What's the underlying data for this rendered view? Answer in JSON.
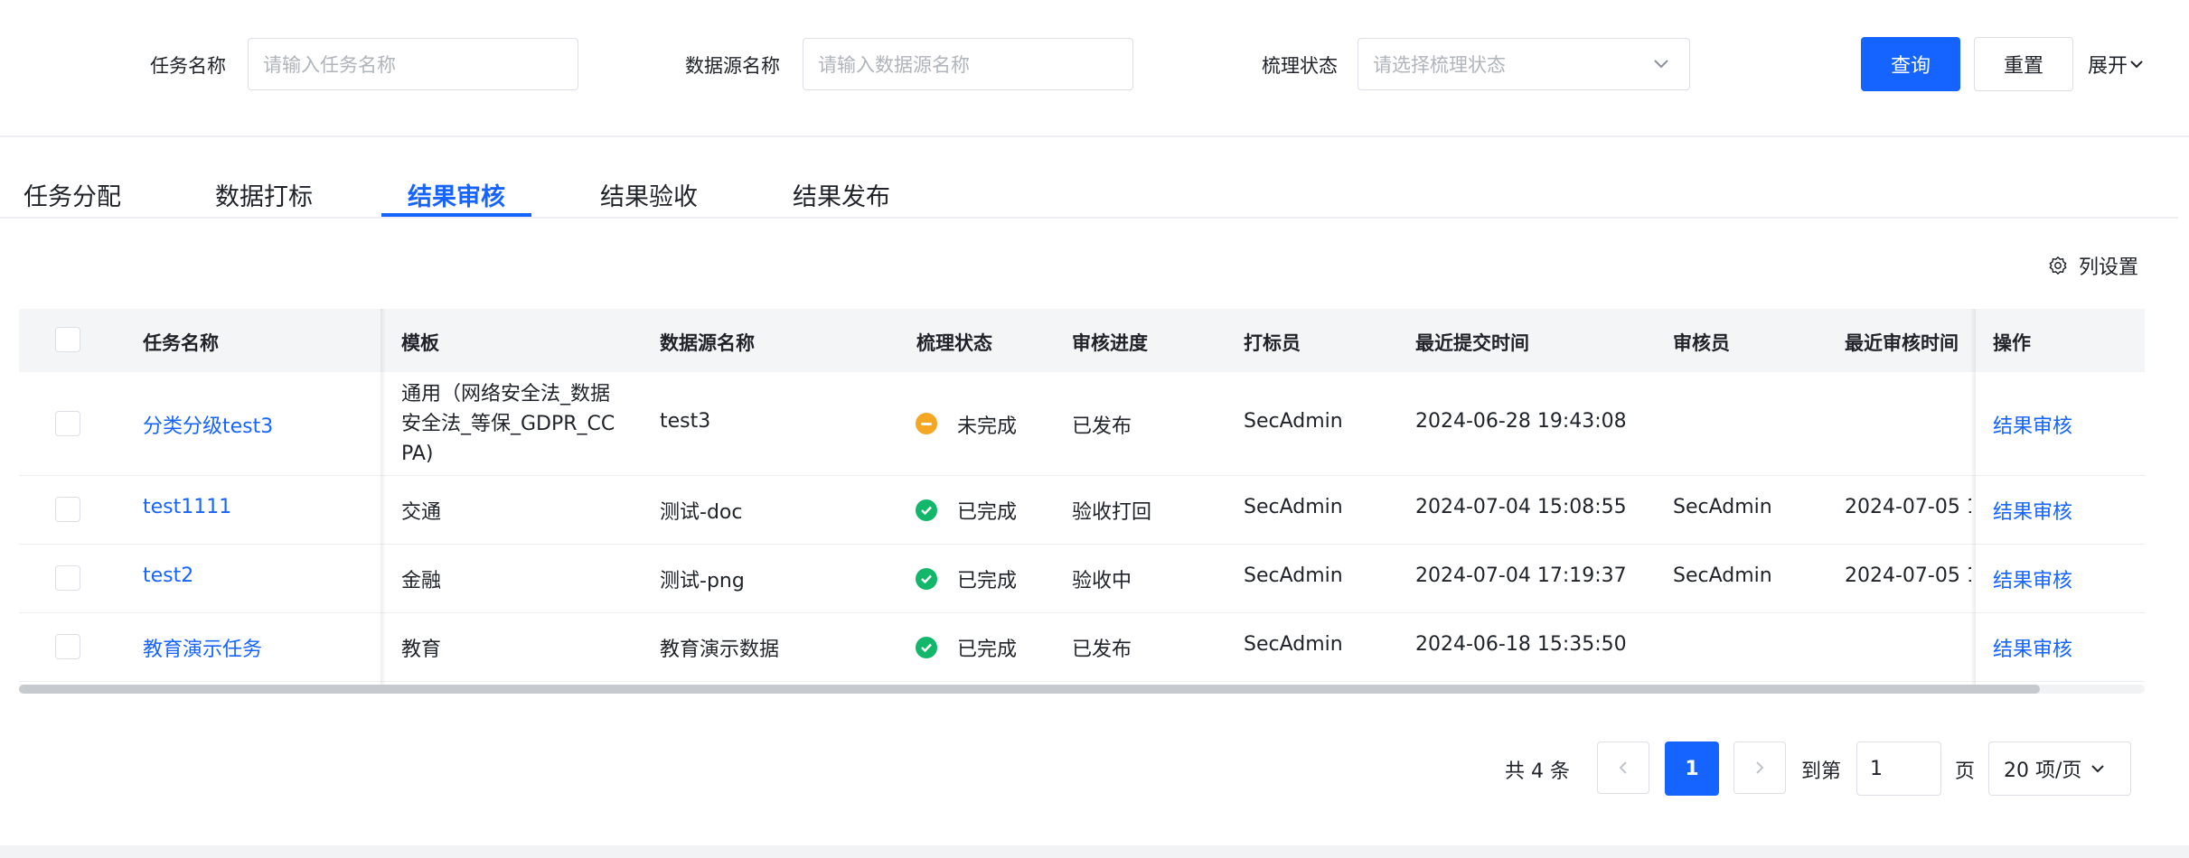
{
  "filters": {
    "task_name_label": "任务名称",
    "task_name_placeholder": "请输入任务名称",
    "datasource_label": "数据源名称",
    "datasource_placeholder": "请输入数据源名称",
    "status_label": "梳理状态",
    "status_placeholder": "请选择梳理状态",
    "query_button": "查询",
    "reset_button": "重置",
    "expand_button": "展开"
  },
  "tabs": [
    "任务分配",
    "数据打标",
    "结果审核",
    "结果验收",
    "结果发布"
  ],
  "active_tab": "结果审核",
  "column_settings": "列设置",
  "table": {
    "headers": [
      "任务名称",
      "模板",
      "数据源名称",
      "梳理状态",
      "审核进度",
      "打标员",
      "最近提交时间",
      "审核员",
      "最近审核时间",
      "操作"
    ],
    "rows": [
      {
        "name": "分类分级test3",
        "template_lines": [
          "通用（网络安全法_数据",
          "安全法_等保_GDPR_CC",
          "PA)"
        ],
        "datasource": "test3",
        "status": "未完成",
        "progress": "已发布",
        "labeler": "SecAdmin",
        "submit_time": "2024-06-28 19:43:08",
        "reviewer": "",
        "review_time": "",
        "action": "结果审核"
      },
      {
        "name": "test1111",
        "template_lines": [
          "交通"
        ],
        "datasource": "测试-doc",
        "status": "已完成",
        "progress": "验收打回",
        "labeler": "SecAdmin",
        "submit_time": "2024-07-04 15:08:55",
        "reviewer": "SecAdmin",
        "review_time": "2024-07-05 1",
        "action": "结果审核"
      },
      {
        "name": "test2",
        "template_lines": [
          "金融"
        ],
        "datasource": "测试-png",
        "status": "已完成",
        "progress": "验收中",
        "labeler": "SecAdmin",
        "submit_time": "2024-07-04 17:19:37",
        "reviewer": "SecAdmin",
        "review_time": "2024-07-05 1",
        "action": "结果审核"
      },
      {
        "name": "教育演示任务",
        "template_lines": [
          "教育"
        ],
        "datasource": "教育演示数据",
        "status": "已完成",
        "progress": "已发布",
        "labeler": "SecAdmin",
        "submit_time": "2024-06-18 15:35:50",
        "reviewer": "",
        "review_time": "",
        "action": "结果审核"
      }
    ]
  },
  "pagination": {
    "total": "共 4 条",
    "current_page": "1",
    "goto_label": "到第",
    "goto_value": "1",
    "page_suffix": "页",
    "page_size": "20 项/页"
  },
  "colors": {
    "primary": "#1664ff",
    "done": "#12b76a",
    "pending": "#f5a623"
  }
}
